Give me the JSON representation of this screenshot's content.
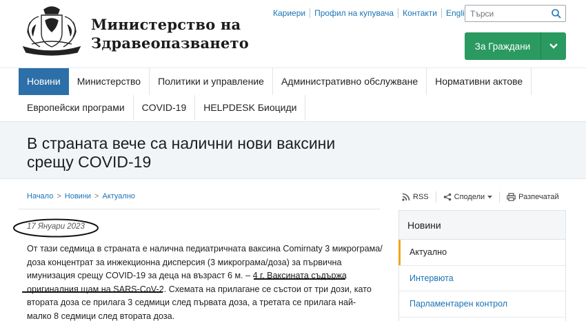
{
  "header": {
    "brand_line1": "Министерство на",
    "brand_line2": "Здравеопазването",
    "top_links": [
      "Кариери",
      "Профил на купувача",
      "Контакти",
      "English"
    ],
    "search_placeholder": "Търси",
    "citizens_button": "За Граждани"
  },
  "nav": {
    "row1": [
      "Новини",
      "Министерство",
      "Политики и управление",
      "Административно обслужване",
      "Нормативни актове"
    ],
    "row2": [
      "Европейски програми",
      "COVID-19",
      "HELPDESK Биоциди"
    ],
    "active": "Новини"
  },
  "page": {
    "title_line1": "В страната вече са налични нови ваксини",
    "title_line2": "срещу COVID-19"
  },
  "breadcrumb": [
    "Начало",
    "Новини",
    "Актуално"
  ],
  "tools": {
    "rss": "RSS",
    "share": "Сподели",
    "print": "Разпечатай"
  },
  "article": {
    "date": "17 Януари 2023",
    "lines": [
      "От тази седмица в страната е налична педиатричната ваксина Comirnaty 3 микрограма/",
      "доза концентрат за инжекционна дисперсия (3 микрограма/доза) за първична",
      "имунизация срещу COVID-19 за деца на възраст  6 м. – 4 г. ",
      "Ваксината съдържа",
      "оригиналния щам на SARS-CoV-2",
      ". Схемата на прилагане се състои от три дози, като",
      "втората доза се прилага 3 седмици след първата доза, а третата се прилага най-",
      "малко 8 седмици след втората доза."
    ]
  },
  "sidebar": {
    "heading": "Новини",
    "items": [
      "Актуално",
      "Интервюта",
      "Парламентарен контрол"
    ]
  },
  "colors": {
    "nav_active": "#2d6fa8",
    "citizens_button": "#2a9a60",
    "link": "#1a73b5",
    "sidebar_active_marker": "#f0a51a"
  }
}
